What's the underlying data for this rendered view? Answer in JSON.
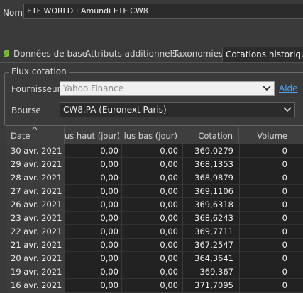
{
  "header": {
    "name_label": "Nom",
    "name_value": "ETF WORLD : Amundi ETF CW8"
  },
  "tabs": [
    {
      "label": "Données de base"
    },
    {
      "label": "Attributs additionnels"
    },
    {
      "label": "Taxonomies"
    },
    {
      "label": "Cotations historiques"
    }
  ],
  "group": {
    "title": "Flux cotation",
    "fournisseur_label": "Fournisseur",
    "fournisseur_value": "Yahoo Finance",
    "aide_label": "Aide",
    "bourse_label": "Bourse",
    "bourse_value": "CW8.PA (Euronext Paris)"
  },
  "table": {
    "columns": [
      "Date",
      "us haut (jour)",
      "lus bas (jour)",
      "Cotation",
      "Volume"
    ],
    "rows": [
      {
        "date": "30 avr. 2021",
        "haut": "0,00",
        "bas": "0,00",
        "cotation": "369,0279",
        "volume": "0"
      },
      {
        "date": "29 avr. 2021",
        "haut": "0,00",
        "bas": "0,00",
        "cotation": "368,1353",
        "volume": "0"
      },
      {
        "date": "28 avr. 2021",
        "haut": "0,00",
        "bas": "0,00",
        "cotation": "368,9879",
        "volume": "0"
      },
      {
        "date": "27 avr. 2021",
        "haut": "0,00",
        "bas": "0,00",
        "cotation": "369,1106",
        "volume": "0"
      },
      {
        "date": "26 avr. 2021",
        "haut": "0,00",
        "bas": "0,00",
        "cotation": "369,6318",
        "volume": "0"
      },
      {
        "date": "23 avr. 2021",
        "haut": "0,00",
        "bas": "0,00",
        "cotation": "368,6243",
        "volume": "0"
      },
      {
        "date": "22 avr. 2021",
        "haut": "0,00",
        "bas": "0,00",
        "cotation": "369,7711",
        "volume": "0"
      },
      {
        "date": "21 avr. 2021",
        "haut": "0,00",
        "bas": "0,00",
        "cotation": "367,2547",
        "volume": "0"
      },
      {
        "date": "20 avr. 2021",
        "haut": "0,00",
        "bas": "0,00",
        "cotation": "364,3641",
        "volume": "0"
      },
      {
        "date": "19 avr. 2021",
        "haut": "0,00",
        "bas": "0,00",
        "cotation": "369,367",
        "volume": "0"
      },
      {
        "date": "16 avr. 2021",
        "haut": "0,00",
        "bas": "0,00",
        "cotation": "371,7095",
        "volume": "0"
      }
    ]
  },
  "colors": {
    "tab_leaf": "#7fbf3f",
    "link": "#4aa3ff"
  }
}
